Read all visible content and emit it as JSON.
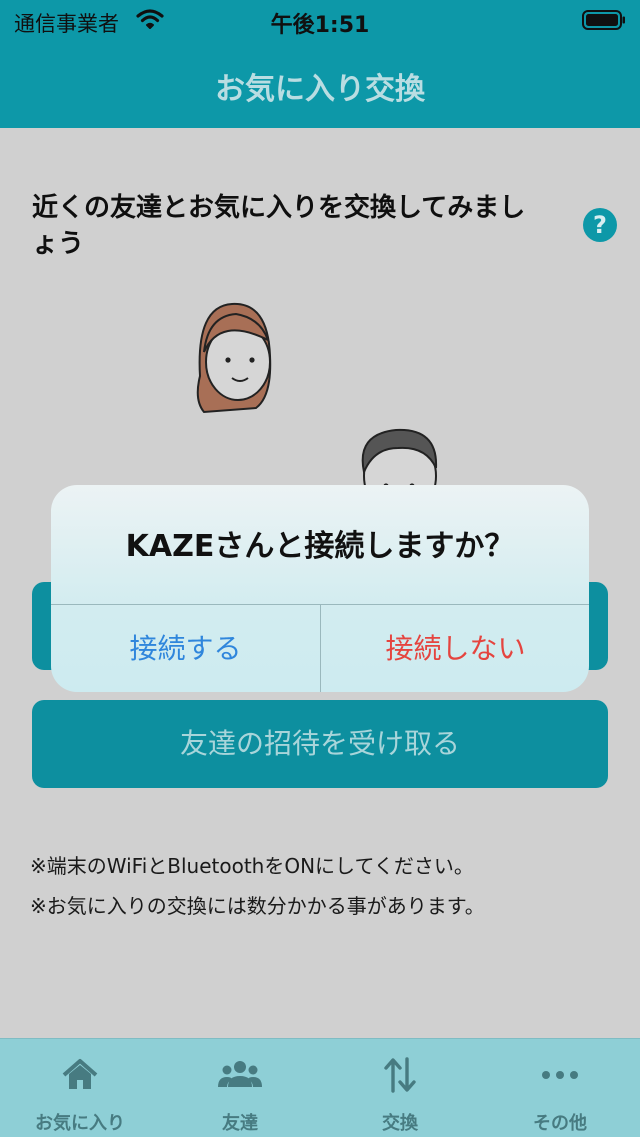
{
  "status_bar": {
    "carrier": "通信事業者",
    "time": "午後1:51"
  },
  "nav": {
    "title": "お気に入り交換"
  },
  "main": {
    "intro_text": "近くの友達とお気に入りを交換してみましょう",
    "help_label": "?",
    "receive_invite_label": "友達の招待を受け取る",
    "notes": [
      "※端末のWiFiとBluetoothをONにしてください。",
      "※お気に入りの交換には数分かかる事があります。"
    ]
  },
  "dialog": {
    "message": "KAZEさんと接続しますか？",
    "confirm_label": "接続する",
    "cancel_label": "接続しない"
  },
  "tabs": [
    {
      "label": "お気に入り",
      "icon": "home-icon"
    },
    {
      "label": "友達",
      "icon": "people-icon"
    },
    {
      "label": "交換",
      "icon": "exchange-icon"
    },
    {
      "label": "その他",
      "icon": "more-icon"
    }
  ],
  "colors": {
    "accent": "#0d98a8",
    "confirm": "#2f86dc",
    "destructive": "#e5443f"
  }
}
